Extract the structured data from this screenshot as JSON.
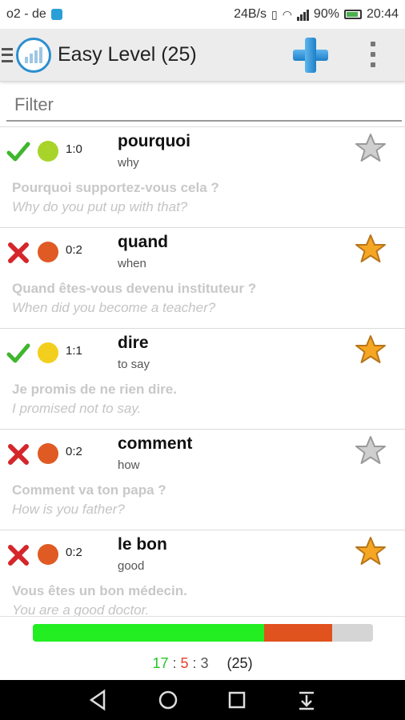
{
  "status": {
    "carrier": "o2 - de",
    "speed": "24B/s",
    "battery": "90%",
    "time": "20:44"
  },
  "appbar": {
    "title": "Easy Level (25)",
    "icons": [
      "menu-icon",
      "app-logo-icon",
      "add-icon",
      "overflow-menu-icon"
    ]
  },
  "filter": {
    "placeholder": "Filter",
    "value": ""
  },
  "items": [
    {
      "result": "correct",
      "dot_color": "#a8d42a",
      "score": "1:0",
      "word": "pourquoi",
      "translation": "why",
      "example_fr": "Pourquoi supportez-vous cela ?",
      "example_en": "Why do you put up with that?",
      "starred": false
    },
    {
      "result": "wrong",
      "dot_color": "#e05a24",
      "score": "0:2",
      "word": "quand",
      "translation": "when",
      "example_fr": "Quand êtes-vous devenu instituteur ?",
      "example_en": "When did you become a teacher?",
      "starred": true
    },
    {
      "result": "correct",
      "dot_color": "#f2cf1c",
      "score": "1:1",
      "word": "dire",
      "translation": "to say",
      "example_fr": "Je promis de ne rien dire.",
      "example_en": "I promised not to say.",
      "starred": true
    },
    {
      "result": "wrong",
      "dot_color": "#e05a24",
      "score": "0:2",
      "word": "comment",
      "translation": "how",
      "example_fr": "Comment va ton papa ?",
      "example_en": "How is you father?",
      "starred": false
    },
    {
      "result": "wrong",
      "dot_color": "#e05a24",
      "score": "0:2",
      "word": "le bon",
      "translation": "good",
      "example_fr": "Vous êtes un bon médecin.",
      "example_en": "You are a good doctor.",
      "starred": true
    }
  ],
  "progress": {
    "correct": 17,
    "wrong": 5,
    "remaining": 3,
    "total_label": "(25)",
    "colors": {
      "correct": "#22ee22",
      "wrong": "#e0521e",
      "remaining": "#d5d5d5"
    }
  },
  "navbar": {
    "icons": [
      "back-icon",
      "home-icon",
      "recents-icon",
      "notifications-down-icon"
    ]
  }
}
